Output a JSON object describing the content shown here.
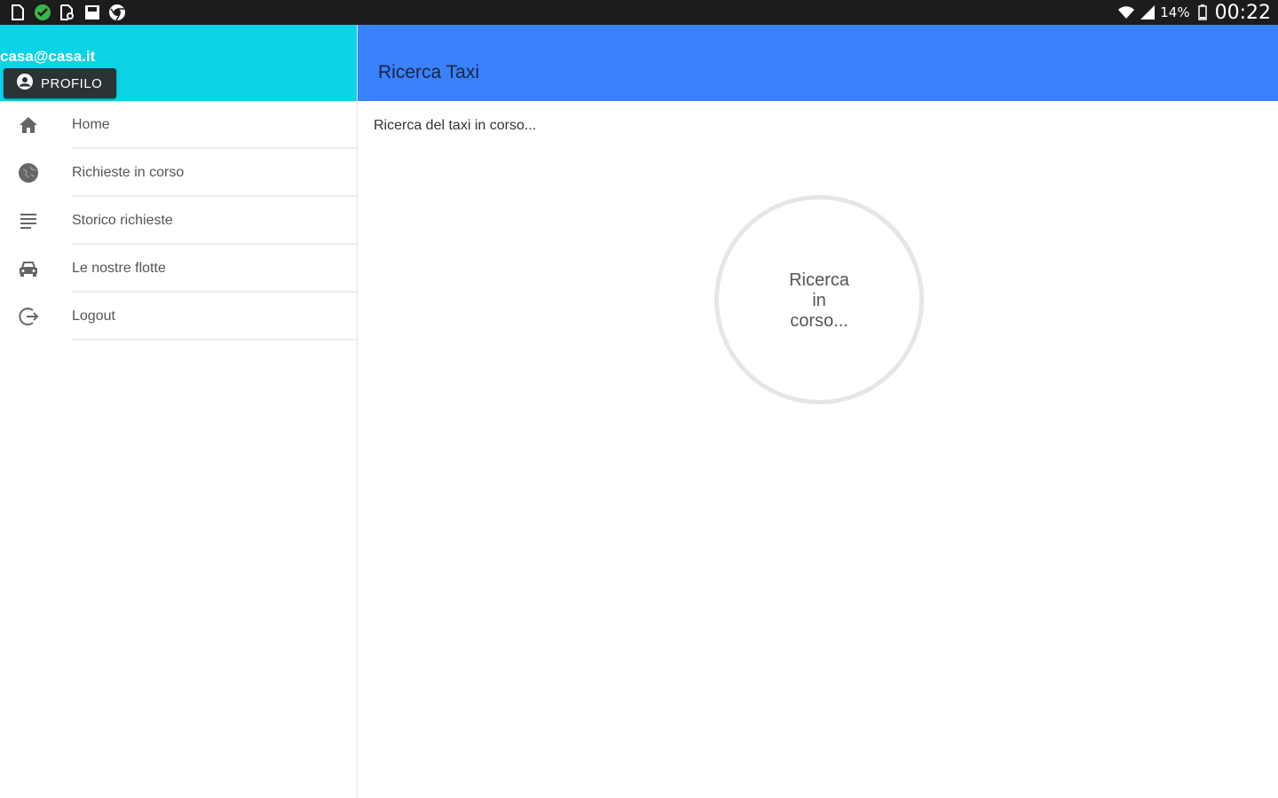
{
  "status_bar": {
    "left_icons": [
      "document-icon",
      "check-circle-icon",
      "file-search-icon",
      "save-icon",
      "chrome-icon"
    ],
    "battery": "14%",
    "time": "00:22"
  },
  "drawer": {
    "header_color": "#0bd3e6",
    "email": "casa@casa.it",
    "profile_button": "PROFILO",
    "items": [
      {
        "label": "Home",
        "icon": "home-icon"
      },
      {
        "label": "Richieste in corso",
        "icon": "globe-icon"
      },
      {
        "label": "Storico richieste",
        "icon": "list-icon"
      },
      {
        "label": "Le nostre flotte",
        "icon": "car-icon"
      },
      {
        "label": "Logout",
        "icon": "logout-icon"
      }
    ]
  },
  "appbar": {
    "color": "#3a81fc",
    "title": "Ricerca Taxi"
  },
  "main": {
    "status_text": "Ricerca del taxi in corso...",
    "spinner_text": "Ricerca in corso..."
  }
}
